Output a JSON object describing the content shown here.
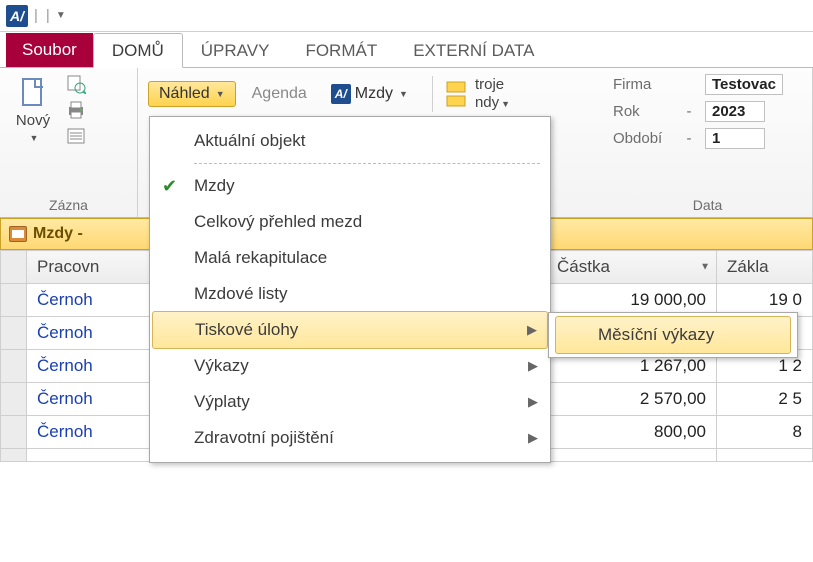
{
  "titlebar": {
    "app_glyph": "A/"
  },
  "tabs": {
    "file": "Soubor",
    "items": [
      "DOMŮ",
      "ÚPRAVY",
      "FORMÁT",
      "EXTERNÍ DATA"
    ],
    "active_index": 0
  },
  "ribbon": {
    "group_zaznamy": {
      "label": "Zázna",
      "new_btn": "Nový"
    },
    "nahled_btn": "Náhled",
    "agenda_btn": "Agenda",
    "mzdy_btn": "Mzdy",
    "nastroje": {
      "line1": "troje",
      "line2": "ndy"
    },
    "menu": {
      "items": [
        {
          "label": "Aktuální objekt",
          "sep_after": true
        },
        {
          "label": "Mzdy",
          "checked": true
        },
        {
          "label": "Celkový přehled mezd"
        },
        {
          "label": "Malá rekapitulace"
        },
        {
          "label": "Mzdové listy"
        },
        {
          "label": "Tiskové úlohy",
          "submenu": true,
          "hover": true
        },
        {
          "label": "Výkazy",
          "submenu": true
        },
        {
          "label": "Výplaty",
          "submenu": true
        },
        {
          "label": "Zdravotní pojištění",
          "submenu": true
        }
      ],
      "submenu_item": "Měsíční výkazy"
    },
    "data_group": {
      "label": "Data",
      "rows": [
        {
          "lbl": "Firma",
          "dash": "",
          "val": "Testovac"
        },
        {
          "lbl": "Rok",
          "dash": "-",
          "val": "2023"
        },
        {
          "lbl": "Období",
          "dash": "-",
          "val": "1"
        }
      ]
    }
  },
  "grid": {
    "tab_title": "Mzdy -",
    "columns": [
      "Pracovn",
      "Částka",
      "Základ"
    ],
    "col2_short": "Zákla",
    "rows": [
      {
        "name": "Černoh",
        "castka": "19 000,00",
        "zaklad": "19 0"
      },
      {
        "name": "Černoh",
        "castka": "",
        "zaklad": ""
      },
      {
        "name": "Černoh",
        "castka": "1 267,00",
        "zaklad": "1 2"
      },
      {
        "name": "Černoh",
        "castka": "2 570,00",
        "zaklad": "2 5"
      },
      {
        "name": "Černoh",
        "castka": "800,00",
        "zaklad": "8"
      }
    ]
  }
}
